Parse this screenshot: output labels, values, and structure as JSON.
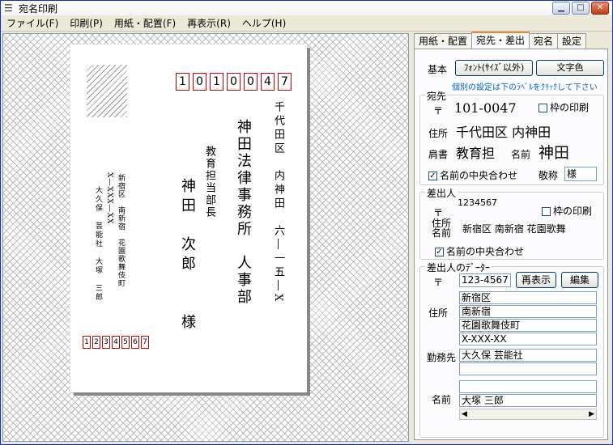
{
  "window": {
    "title": "宛名印刷"
  },
  "menu": [
    "ファイル(F)",
    "印刷(P)",
    "用紙・配置(F)",
    "再表示(R)",
    "ヘルプ(H)"
  ],
  "card": {
    "zip_to": [
      "1",
      "0",
      "1",
      "0",
      "0",
      "4",
      "7"
    ],
    "address1": "千代田区　内神田　六―一五―X",
    "company": "神田法律事務所　人事部",
    "position": "教育担当部長",
    "name": "神田　次郎　　様",
    "sender_address1": "新宿区　南新宿　花園歌舞伎町",
    "sender_address2": "X―XXX―XX",
    "sender_company": "大久保　芸能社　大塚　三郎",
    "zip_from": [
      "1",
      "2",
      "3",
      "4",
      "5",
      "6",
      "7"
    ]
  },
  "panel": {
    "tabs": [
      "用紙・配置",
      "宛先・差出",
      "宛名",
      "設定"
    ],
    "basic_label": "基本",
    "font_button": "ﾌｫﾝﾄ(ｻｲｽﾞ以外)",
    "color_button": "文字色",
    "hint": "個別の設定は下のﾗﾍﾞﾙをｸﾘｯｸして下さい",
    "to": {
      "title": "宛先",
      "zip_mark": "〒",
      "zip": "101-0047",
      "frame_print": "枠の印刷",
      "address_label": "住所",
      "address": "千代田区 内神田",
      "title_label": "肩書",
      "position": "教育担",
      "name_label": "名前",
      "name": "神田",
      "center_name": "名前の中央合わせ",
      "honorific_label": "敬称",
      "honorific": "様"
    },
    "from": {
      "title": "差出人",
      "zip_mark": "〒",
      "zip": "1234567",
      "frame_print": "枠の印刷",
      "addr_label1": "住所",
      "addr_label2": "名前",
      "addr_preview": "新宿区 南新宿 花園歌舞",
      "center_name": "名前の中央合わせ"
    },
    "sender_data": {
      "title": "差出人のﾃﾞｰﾀｰ",
      "zip_mark": "〒",
      "zip": "123-4567",
      "refresh_button": "再表示",
      "edit_button": "編集",
      "address_label": "住所",
      "address_lines": [
        "新宿区",
        "南新宿",
        "花園歌舞伎町",
        "X-XXX-XX"
      ],
      "work_label": "勤務先",
      "work_lines": [
        "大久保 芸能社",
        ""
      ],
      "name_label": "名前",
      "name_lines": [
        "",
        "大塚 三郎"
      ]
    }
  }
}
